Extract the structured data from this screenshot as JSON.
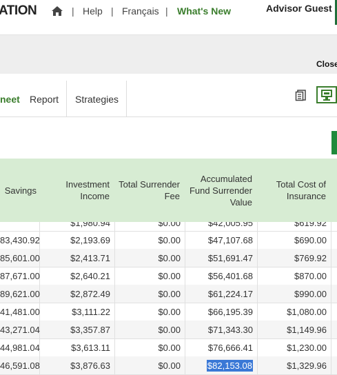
{
  "header": {
    "brand": "ATION",
    "nav": {
      "separator": "|",
      "help": "Help",
      "french": "Français",
      "whats_new": "What's New"
    },
    "user": "Advisor Guest"
  },
  "panel": {
    "close": "Close"
  },
  "tabs": [
    {
      "label": "neet",
      "active": true
    },
    {
      "label": "Report",
      "active": false
    },
    {
      "label": "Strategies",
      "active": false
    }
  ],
  "toolbar": {
    "icons": [
      "document-icon",
      "monitor-icon"
    ]
  },
  "table": {
    "headers": [
      "Savings",
      "Investment Income",
      "Total Surrender Fee",
      "Accumulated Fund Surrender Value",
      "Total Cost of Insurance"
    ],
    "partial_row": [
      "         ",
      "$1,980.94",
      "$0.00",
      "$42,005.95",
      "$619.92"
    ],
    "rows": [
      [
        "83,430.92",
        "$2,193.69",
        "$0.00",
        "$47,107.68",
        "$690.00"
      ],
      [
        "85,601.00",
        "$2,413.71",
        "$0.00",
        "$51,691.47",
        "$769.92"
      ],
      [
        "87,671.00",
        "$2,640.21",
        "$0.00",
        "$56,401.68",
        "$870.00"
      ],
      [
        "89,621.00",
        "$2,872.49",
        "$0.00",
        "$61,224.17",
        "$990.00"
      ],
      [
        "41,481.00",
        "$3,111.22",
        "$0.00",
        "$66,195.39",
        "$1,080.00"
      ],
      [
        "43,271.04",
        "$3,357.87",
        "$0.00",
        "$71,343.30",
        "$1,149.96"
      ],
      [
        "44,981.04",
        "$3,613.11",
        "$0.00",
        "$76,666.41",
        "$1,230.00"
      ],
      [
        "46,591.08",
        "$3,876.63",
        "$0.00",
        "$82,153.08",
        "$1,329.96"
      ]
    ],
    "selected_cell": {
      "row": 7,
      "col": 3
    }
  },
  "colors": {
    "accent": "#3a7d2c",
    "header_bg": "#d7ecd3",
    "selection": "#3a78d6"
  }
}
